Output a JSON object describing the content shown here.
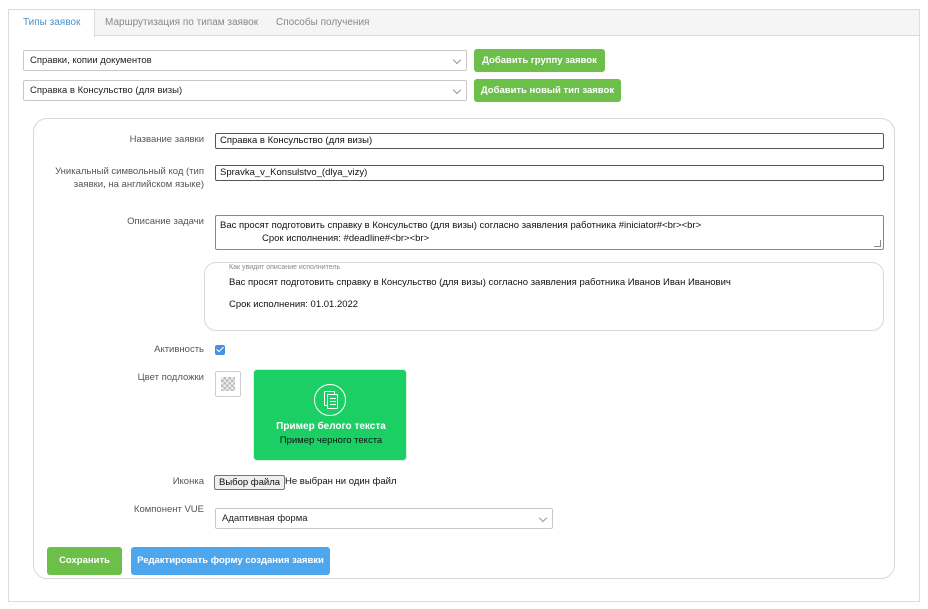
{
  "tabs": [
    {
      "label": "Типы заявок",
      "active": true
    },
    {
      "label": "Маршрутизация по типам заявок",
      "active": false
    },
    {
      "label": "Способы получения",
      "active": false
    }
  ],
  "top": {
    "group_select": "Справки, копии документов",
    "type_select": "Справка в Консульство (для визы)",
    "add_group_label": "Добавить группу заявок",
    "add_type_label": "Добавить новый тип заявок"
  },
  "form": {
    "name_label": "Название заявки",
    "name_value": "Справка в Консульство (для визы)",
    "code_label_line1": "Уникальный символьный код (тип",
    "code_label_line2": "заявки, на английском языке)",
    "code_value": "Spravka_v_Konsulstvo_(dlya_vizy)",
    "desc_label": "Описание задачи",
    "desc_line1": "Вас просят подготовить справку в Консульство (для визы) согласно заявления работника #iniciator#<br><br>",
    "desc_line2": "Срок исполнения: #deadline#<br><br>",
    "preview_caption": "Как увидит описание исполнитель",
    "preview_line1": "Вас просят подготовить справку в Консульство (для визы) согласно заявления работника Иванов Иван Иванович",
    "preview_line2": "Срок исполнения: 01.01.2022",
    "active_label": "Активность",
    "active_checked": true,
    "color_label": "Цвет подложки",
    "sample_color": "#1ccf65",
    "sample_white": "Пример белого текста",
    "sample_black": "Пример черного текста",
    "sample_icon": "document-icon",
    "icon_label": "Иконка",
    "file_button": "Выбор файла",
    "file_status": "Не выбран ни один файл",
    "vue_label": "Компонент VUE",
    "vue_value": "Адаптивная форма",
    "save_label": "Сохранить",
    "edit_label": "Редактировать форму создания заявки"
  },
  "colors": {
    "accent_green": "#6cc04a",
    "accent_blue": "#4ca7ee",
    "tab_active": "#4a90c8",
    "checkbox": "#4a90e2"
  }
}
